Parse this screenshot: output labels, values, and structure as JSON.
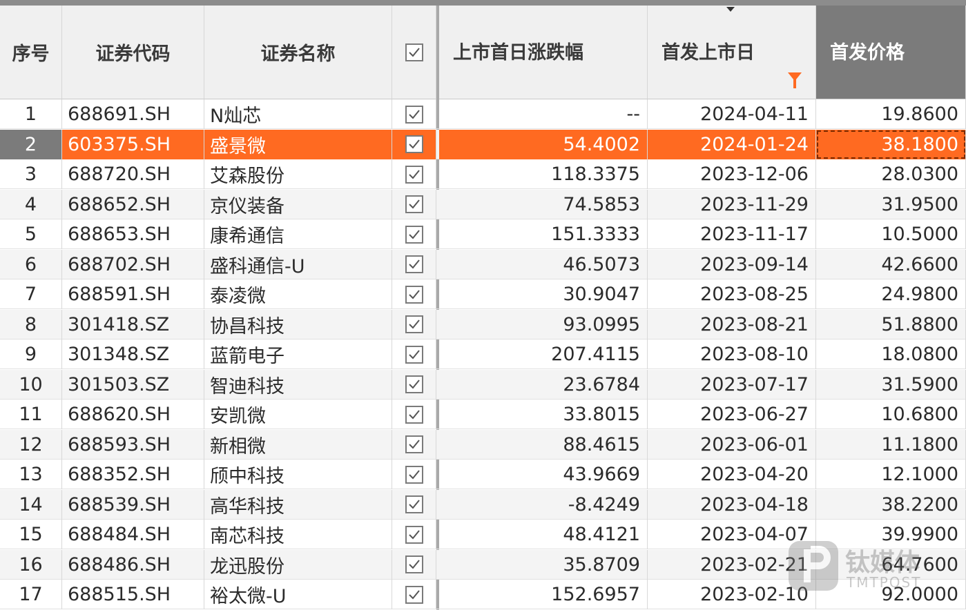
{
  "columns": [
    {
      "key": "idx",
      "label": "序号"
    },
    {
      "key": "code",
      "label": "证券代码"
    },
    {
      "key": "name",
      "label": "证券名称"
    },
    {
      "key": "check",
      "label": ""
    },
    {
      "key": "chg",
      "label": "上市首日涨跌幅"
    },
    {
      "key": "date",
      "label": "首发上市日"
    },
    {
      "key": "price",
      "label": "首发价格"
    }
  ],
  "rows": [
    {
      "idx": "1",
      "code": "688691.SH",
      "name": "N灿芯",
      "chg": "--",
      "date": "2024-04-11",
      "price": "19.8600"
    },
    {
      "idx": "2",
      "code": "603375.SH",
      "name": "盛景微",
      "chg": "54.4002",
      "date": "2024-01-24",
      "price": "38.1800"
    },
    {
      "idx": "3",
      "code": "688720.SH",
      "name": "艾森股份",
      "chg": "118.3375",
      "date": "2023-12-06",
      "price": "28.0300"
    },
    {
      "idx": "4",
      "code": "688652.SH",
      "name": "京仪装备",
      "chg": "74.5853",
      "date": "2023-11-29",
      "price": "31.9500"
    },
    {
      "idx": "5",
      "code": "688653.SH",
      "name": "康希通信",
      "chg": "151.3333",
      "date": "2023-11-17",
      "price": "10.5000"
    },
    {
      "idx": "6",
      "code": "688702.SH",
      "name": "盛科通信-U",
      "chg": "46.5073",
      "date": "2023-09-14",
      "price": "42.6600"
    },
    {
      "idx": "7",
      "code": "688591.SH",
      "name": "泰凌微",
      "chg": "30.9047",
      "date": "2023-08-25",
      "price": "24.9800"
    },
    {
      "idx": "8",
      "code": "301418.SZ",
      "name": "协昌科技",
      "chg": "93.0995",
      "date": "2023-08-21",
      "price": "51.8800"
    },
    {
      "idx": "9",
      "code": "301348.SZ",
      "name": "蓝箭电子",
      "chg": "207.4115",
      "date": "2023-08-10",
      "price": "18.0800"
    },
    {
      "idx": "10",
      "code": "301503.SZ",
      "name": "智迪科技",
      "chg": "23.6784",
      "date": "2023-07-17",
      "price": "31.5900"
    },
    {
      "idx": "11",
      "code": "688620.SH",
      "name": "安凯微",
      "chg": "33.8015",
      "date": "2023-06-27",
      "price": "10.6800"
    },
    {
      "idx": "12",
      "code": "688593.SH",
      "name": "新相微",
      "chg": "88.4615",
      "date": "2023-06-01",
      "price": "11.1800"
    },
    {
      "idx": "13",
      "code": "688352.SH",
      "name": "颀中科技",
      "chg": "43.9669",
      "date": "2023-04-20",
      "price": "12.1000"
    },
    {
      "idx": "14",
      "code": "688539.SH",
      "name": "高华科技",
      "chg": "-8.4249",
      "date": "2023-04-18",
      "price": "38.2200"
    },
    {
      "idx": "15",
      "code": "688484.SH",
      "name": "南芯科技",
      "chg": "48.4121",
      "date": "2023-04-07",
      "price": "39.9900"
    },
    {
      "idx": "16",
      "code": "688486.SH",
      "name": "龙迅股份",
      "chg": "35.8709",
      "date": "2023-02-21",
      "price": "64.7600"
    },
    {
      "idx": "17",
      "code": "688515.SH",
      "name": "裕太微-U",
      "chg": "152.6957",
      "date": "2023-02-10",
      "price": "92.0000"
    }
  ],
  "selected_row": "2",
  "checked_all": true,
  "sort": {
    "column": "首发上市日",
    "direction": "desc"
  },
  "filter": {
    "column": "首发上市日",
    "icon": "filter-icon"
  },
  "colors": {
    "accent": "#ff6a21",
    "header_bg": "#f0f0f0",
    "active_header_bg": "#7b7b7b"
  },
  "watermark": {
    "cn": "钛媒体",
    "en": "TMTPOST"
  }
}
